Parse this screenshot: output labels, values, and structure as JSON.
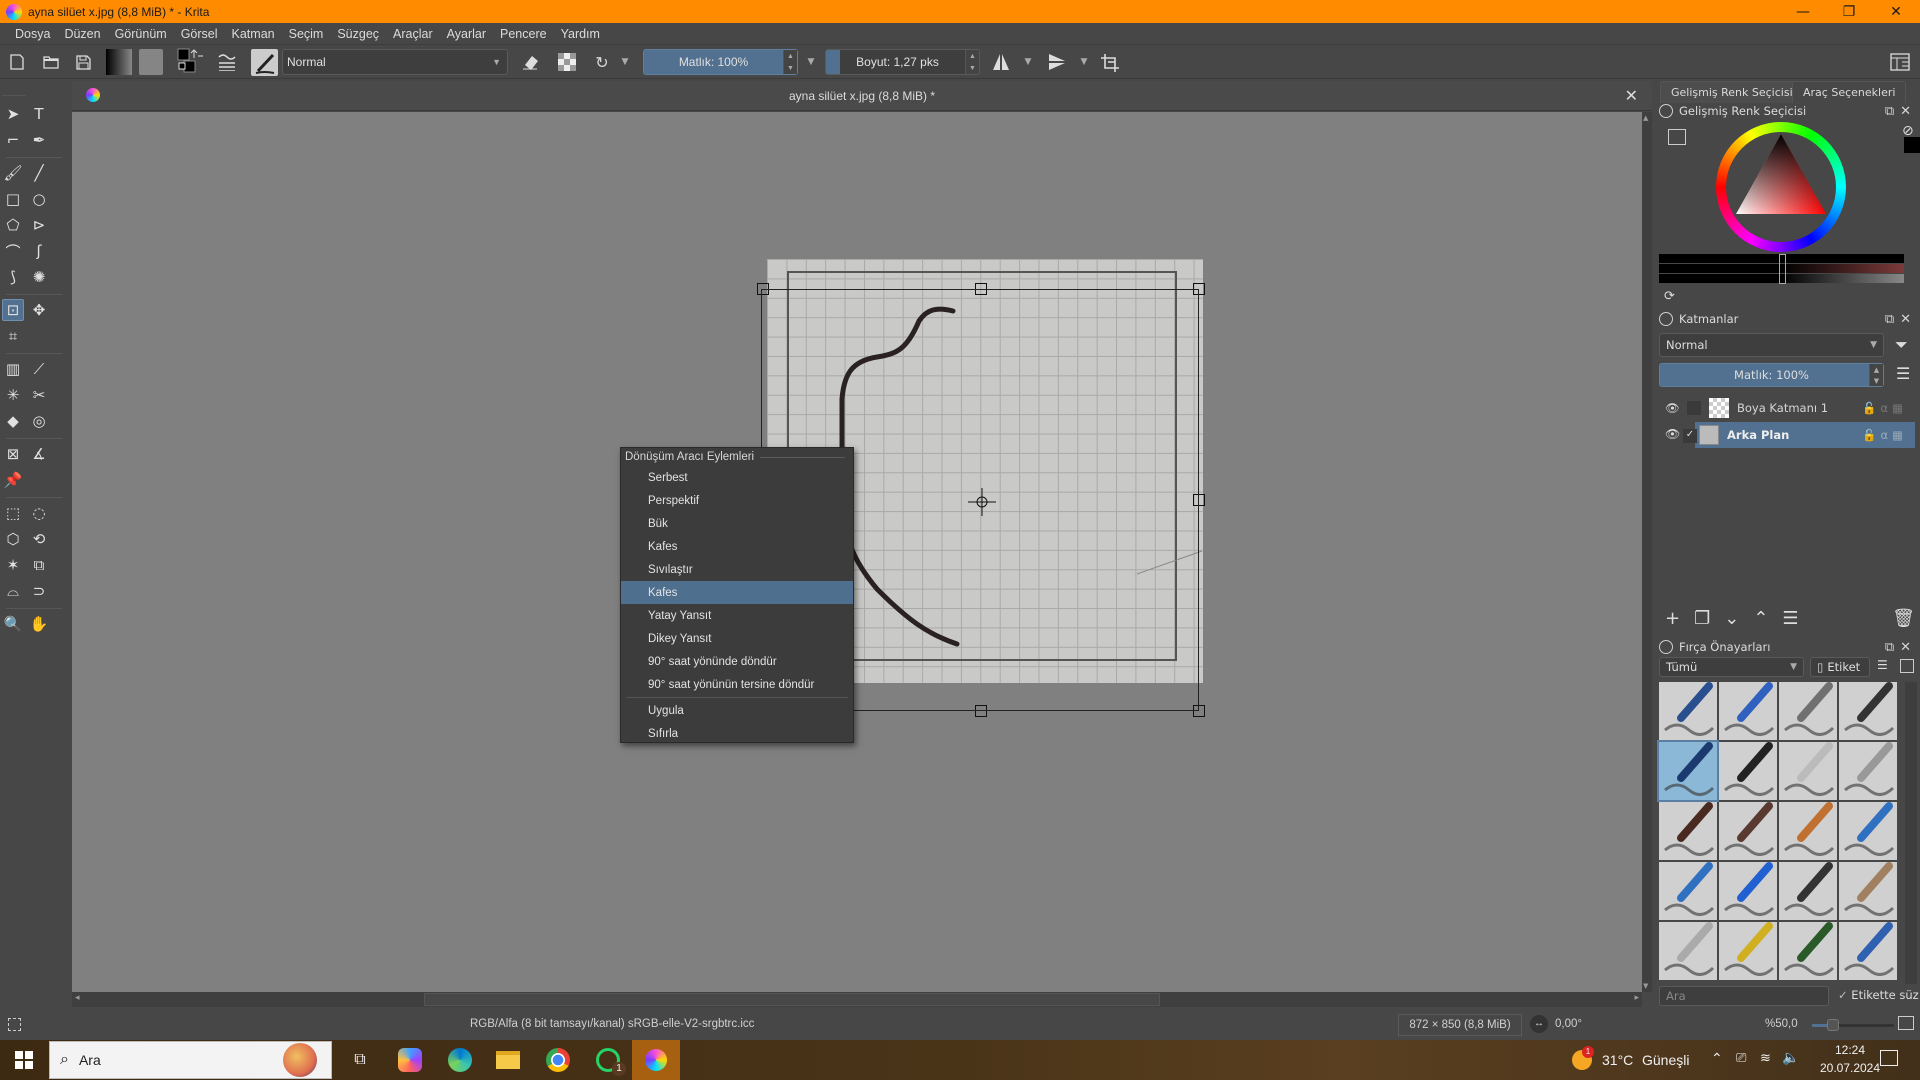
{
  "window": {
    "title": "ayna silüet x.jpg (8,8 MiB) * - Krita",
    "controls": {
      "minimize": "—",
      "maximize": "❐",
      "close": "✕"
    }
  },
  "menu": [
    "Dosya",
    "Düzen",
    "Görünüm",
    "Görsel",
    "Katman",
    "Seçim",
    "Süzgeç",
    "Araçlar",
    "Ayarlar",
    "Pencere",
    "Yardım"
  ],
  "toolbar": {
    "blend_mode": "Normal",
    "opacity": "Matlık: 100%",
    "size": "Boyut: 1,27 pks",
    "icons": [
      "new-document-icon",
      "open-document-icon",
      "save-icon",
      "gradient-icon",
      "pattern-icon",
      "color-swap-icon",
      "brush-settings-icon",
      "brush-preset-icon",
      "eraser-mode-icon",
      "alpha-lock-icon",
      "reload-preset-icon",
      "mirror-horizontal-icon",
      "mirror-vertical-icon",
      "wrap-around-icon",
      "workspace-icon"
    ]
  },
  "document": {
    "tab_title": "ayna silüet x.jpg (8,8 MiB) *"
  },
  "context_menu": {
    "header": "Dönüşüm Aracı Eylemleri",
    "items": [
      {
        "label": "Serbest",
        "selected": false
      },
      {
        "label": "Perspektif",
        "selected": false
      },
      {
        "label": "Bük",
        "selected": false
      },
      {
        "label": "Kafes",
        "selected": false
      },
      {
        "label": "Sıvılaştır",
        "selected": false
      },
      {
        "label": "Kafes",
        "selected": true
      },
      {
        "label": "Yatay Yansıt",
        "selected": false
      },
      {
        "label": "Dikey Yansıt",
        "selected": false
      },
      {
        "label": "90° saat yönünde döndür",
        "selected": false
      },
      {
        "label": "90° saat yönünün tersine döndür",
        "selected": false
      },
      {
        "label": "Uygula",
        "selected": false
      },
      {
        "label": "Sıfırla",
        "selected": false
      }
    ]
  },
  "toolbox": {
    "active_tool": "transform-tool",
    "tools": [
      "select-shapes",
      "text",
      "edit-shapes",
      "calligraphy",
      "freehand-brush",
      "line",
      "rectangle",
      "ellipse",
      "polygon",
      "polyline",
      "bezier-curve",
      "freehand-path",
      "dynamic-brush",
      "multibrush",
      "transform",
      "move",
      "crop",
      "gradient",
      "color-sampler",
      "colorize-mask",
      "smart-patch",
      "fill",
      "enclose-fill",
      "assistant",
      "measure",
      "reference-images",
      "rect-select",
      "ellipse-select",
      "polygon-select",
      "freehand-select",
      "contiguous-select",
      "similar-select",
      "bezier-select",
      "magnetic-select",
      "zoom",
      "pan"
    ]
  },
  "dock": {
    "tabs": [
      "Gelişmiş Renk Seçicisi",
      "Araç Seçenekleri"
    ],
    "color_selector": {
      "title": "Gelişmiş Renk Seçicisi",
      "hue_color": "#ff0000"
    },
    "layers": {
      "title": "Katmanlar",
      "blend_mode": "Normal",
      "opacity": "Matlık:  100%",
      "items": [
        {
          "name": "Boya Katmanı 1",
          "visible": true,
          "selected": false,
          "checked": false
        },
        {
          "name": "Arka Plan",
          "visible": true,
          "selected": true,
          "checked": true
        }
      ]
    },
    "brush_presets": {
      "title": "Fırça Önayarları",
      "filter": "Tümü",
      "tag_button": "Etiket",
      "search_placeholder": "Ara",
      "filter_in_tag": "Etikette süz",
      "selected_index": 4,
      "count": 20
    }
  },
  "status": {
    "color_profile": "RGB/Alfa (8 bit tamsayı/kanal) sRGB-elle-V2-srgbtrc.icc",
    "image_size": "872 × 850 (8,8 MiB)",
    "rotation": "0,00°",
    "zoom": "%50,0",
    "zoom_level": 0.25
  },
  "taskbar": {
    "search_placeholder": "Ara",
    "weather": {
      "temp": "31°C",
      "condition": "Güneşli",
      "badge": "1"
    },
    "whatsapp_badge": "1",
    "time": "12:24",
    "date": "20.07.2024",
    "apps": [
      "task-view",
      "copilot",
      "edge",
      "file-explorer",
      "chrome",
      "whatsapp",
      "krita"
    ]
  },
  "colors": {
    "titlebar": "#ff8c00",
    "accent": "#4f6f8f",
    "panel_bg": "#474747",
    "canvas_bg": "#808080"
  }
}
